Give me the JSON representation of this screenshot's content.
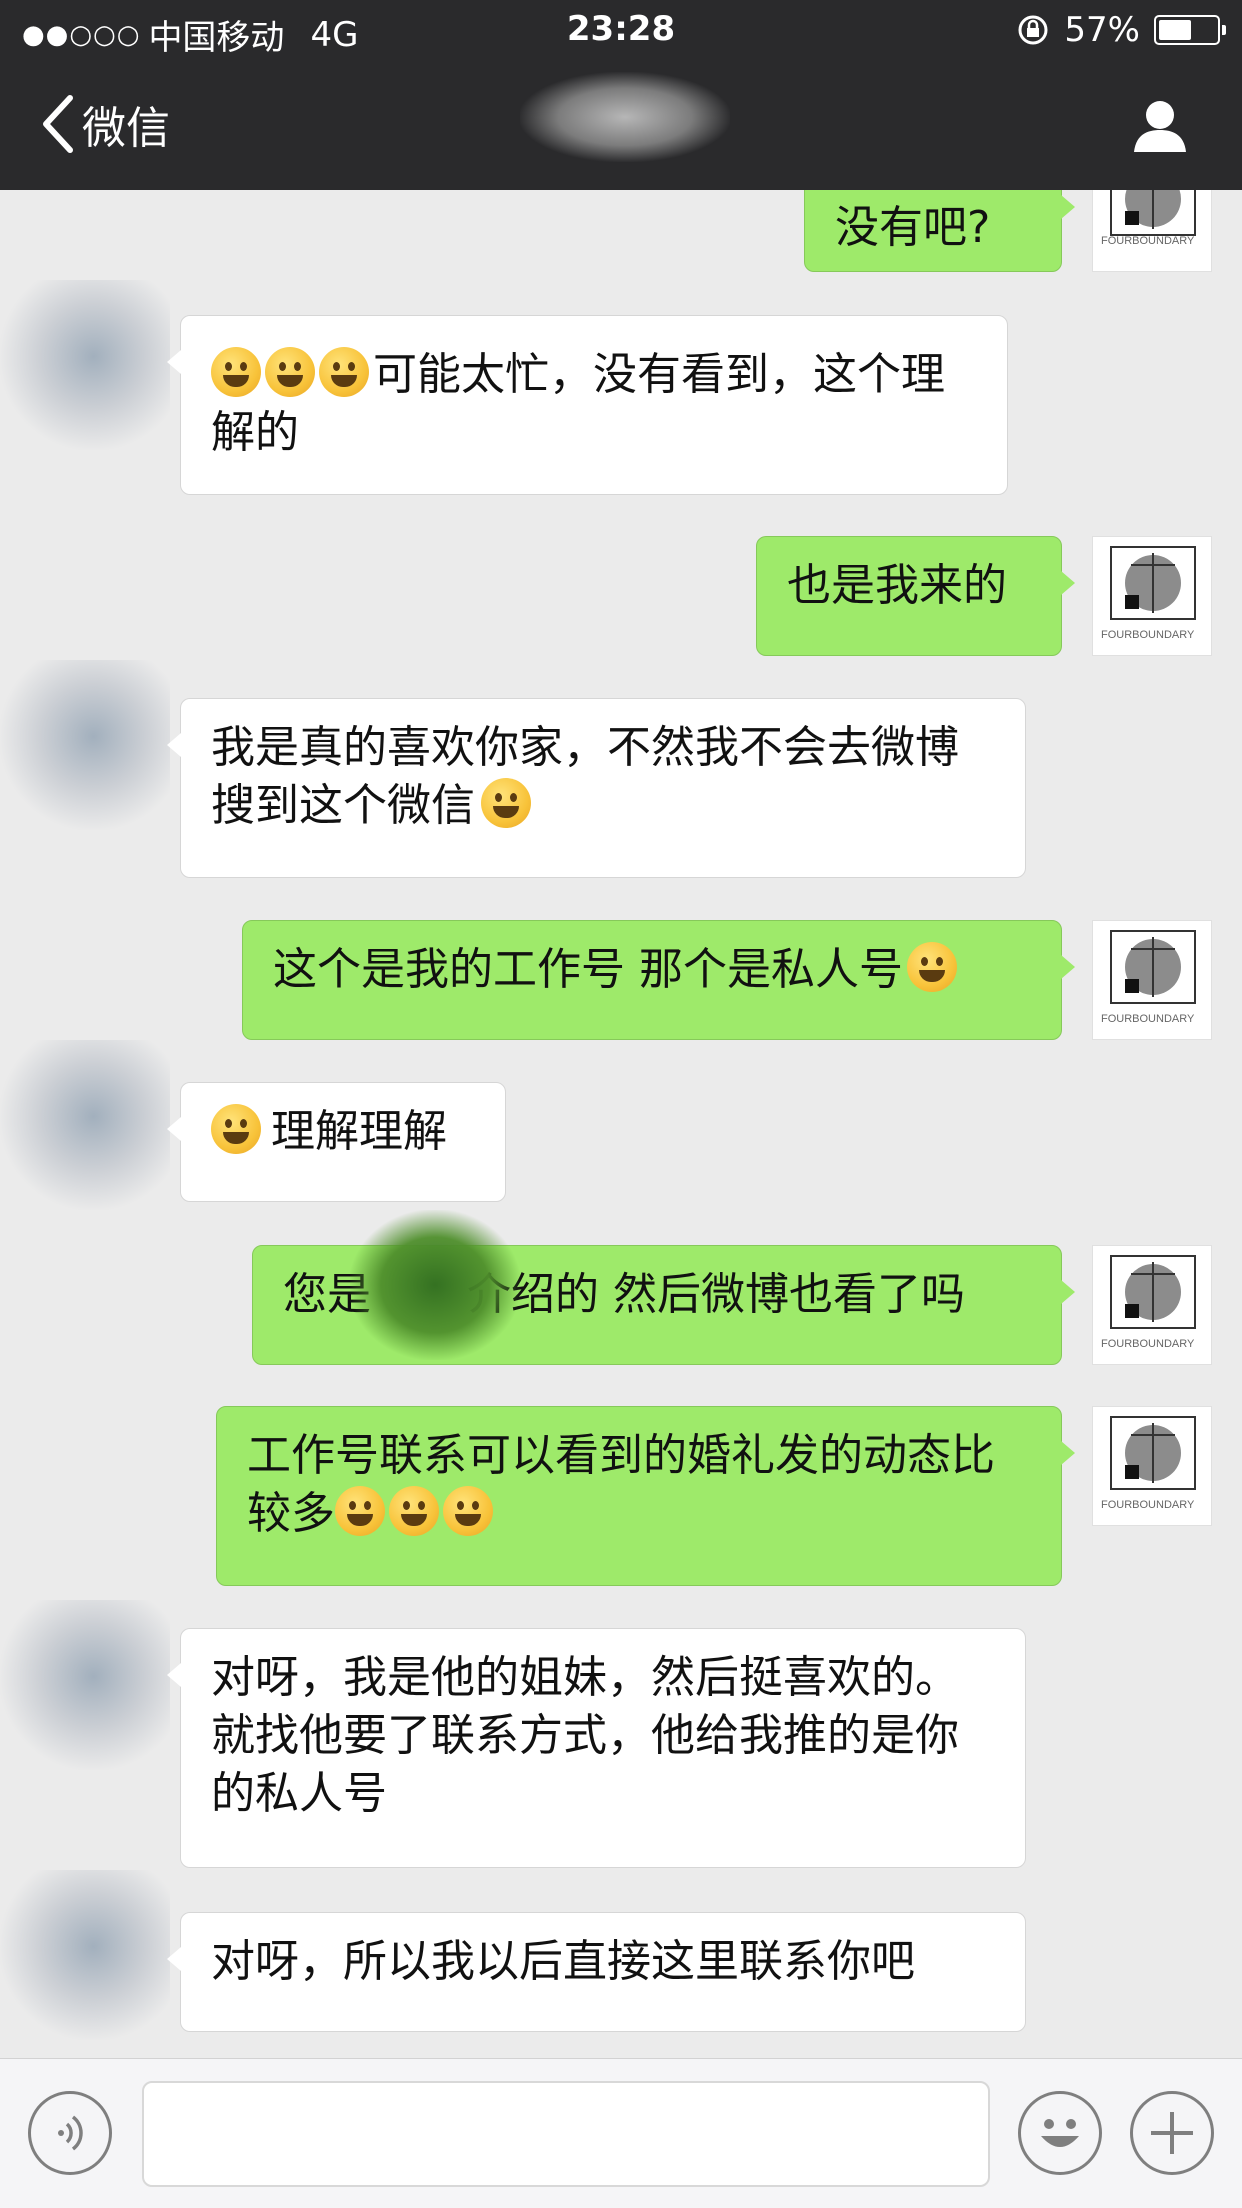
{
  "status_bar": {
    "signal_dots": "●●○○○",
    "carrier": "中国移动",
    "network": "4G",
    "time": "23:28",
    "battery_percent_text": "57%",
    "battery_level": 0.57
  },
  "nav": {
    "back_label": "微信"
  },
  "messages": [
    {
      "from": "me",
      "text": "没有吧?"
    },
    {
      "from": "other",
      "emoji_count": 3,
      "text": "可能太忙，没有看到，这个理解的"
    },
    {
      "from": "me",
      "text": "也是我来的"
    },
    {
      "from": "other",
      "text": "我是真的喜欢你家，不然我不会去微博搜到这个微信",
      "trailing_emoji": true
    },
    {
      "from": "me",
      "text": "这个是我的工作号 那个是私人号",
      "trailing_emoji": true
    },
    {
      "from": "other",
      "leading_emoji": true,
      "text": "理解理解"
    },
    {
      "from": "me",
      "text_before": "您是",
      "text_after": "介绍的 然后微博也看了吗"
    },
    {
      "from": "me",
      "text": "工作号联系可以看到的婚礼发的动态比较多",
      "emoji_count": 3
    },
    {
      "from": "other",
      "text": "对呀，我是他的姐妹，然后挺喜欢的。就找他要了联系方式，他给我推的是你的私人号"
    },
    {
      "from": "other",
      "text": "对呀，所以我以后直接这里联系你吧"
    }
  ],
  "avatar_logo_text": "FOURBOUNDARY",
  "icons": {
    "back": "chevron-left-icon",
    "profile": "person-icon",
    "voice": "voice-icon",
    "emoji": "emoji-icon",
    "add": "plus-icon"
  },
  "colors": {
    "bar_bg": "#2a2a2c",
    "chat_bg": "#ebebeb",
    "bubble_out": "#9eea6a",
    "bubble_in": "#ffffff"
  }
}
